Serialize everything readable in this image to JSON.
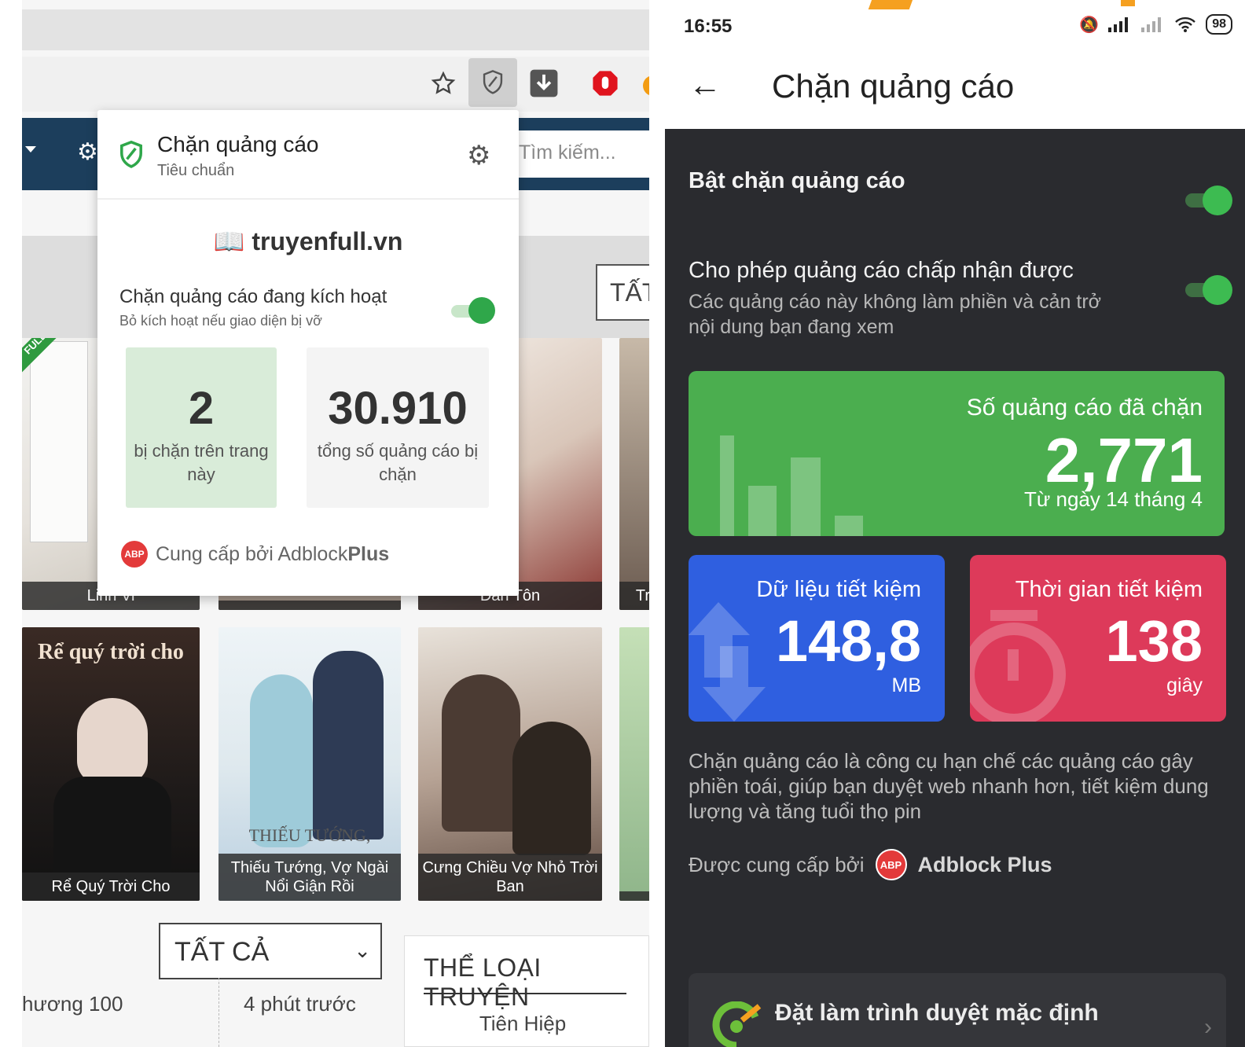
{
  "desktop": {
    "search_placeholder": "Tìm kiếm...",
    "tat_button": "TẤT",
    "books_row1": [
      {
        "caption": "Linh Vi"
      },
      {
        "caption": ""
      },
      {
        "caption": "Đan Tôn"
      },
      {
        "caption": "Tr"
      }
    ],
    "books_row2": [
      {
        "caption": "Rể Quý Trời Cho",
        "cover_text": "Rể quý trời cho"
      },
      {
        "caption": "Thiếu Tướng, Vợ Ngài Nổi Giận Rồi",
        "cover_text": "THIẾU TƯỚNG,"
      },
      {
        "caption": "Cưng Chiều Vợ Nhỏ Trời Ban",
        "cover_text": ""
      },
      {
        "caption": ""
      }
    ],
    "full_ribbon": "FULL",
    "select_value": "TẤT CẢ",
    "list_row": {
      "chapter": "hương 100",
      "time": "4 phút trước"
    },
    "genre": {
      "title": "THỂ LOẠI TRUYỆN",
      "first_item": "Tiên Hiệp"
    },
    "popup": {
      "title": "Chặn quảng cáo",
      "subtitle": "Tiêu chuẩn",
      "domain": "truyenfull.vn",
      "active_label": "Chặn quảng cáo đang kích hoạt",
      "active_hint": "Bỏ kích hoạt nếu giao diện bị vỡ",
      "toggle_on": true,
      "page_blocked": "2",
      "page_blocked_label": "bị chặn trên trang này",
      "total_blocked": "30.910",
      "total_blocked_label": "tổng số quảng cáo bị chặn",
      "footer_prefix": "Cung cấp bởi Adblock",
      "footer_brand": "Plus",
      "badge": "ABP"
    }
  },
  "mobile": {
    "time": "16:55",
    "battery": "98",
    "title": "Chặn quảng cáo",
    "enable_label": "Bật chặn quảng cáo",
    "enable_on": true,
    "acceptable_label": "Cho phép quảng cáo chấp nhận được",
    "acceptable_desc": "Các quảng cáo này không làm phiền và cản trở nội dung bạn đang xem",
    "acceptable_on": true,
    "ads_blocked": {
      "label": "Số quảng cáo đã chặn",
      "value": "2,771",
      "since": "Từ ngày 14 tháng 4"
    },
    "data_saved": {
      "label": "Dữ liệu tiết kiệm",
      "value": "148,8",
      "unit": "MB"
    },
    "time_saved": {
      "label": "Thời gian tiết kiệm",
      "value": "138",
      "unit": "giây"
    },
    "about": "Chặn quảng cáo là công cụ hạn chế các quảng cáo gây phiền toái, giúp bạn duyệt web nhanh hơn, tiết kiệm dung lượng và tăng tuổi thọ pin",
    "provided_by": "Được cung cấp bởi",
    "provider": "Adblock Plus",
    "badge": "ABP",
    "default_browser": "Đặt làm trình duyệt mặc định"
  },
  "colors": {
    "green_card": "#4bae4f",
    "blue_card": "#2f5fe0",
    "red_card": "#dd3a5a",
    "toggle_green": "#3dbb51",
    "navbar": "#1c3e5c"
  }
}
